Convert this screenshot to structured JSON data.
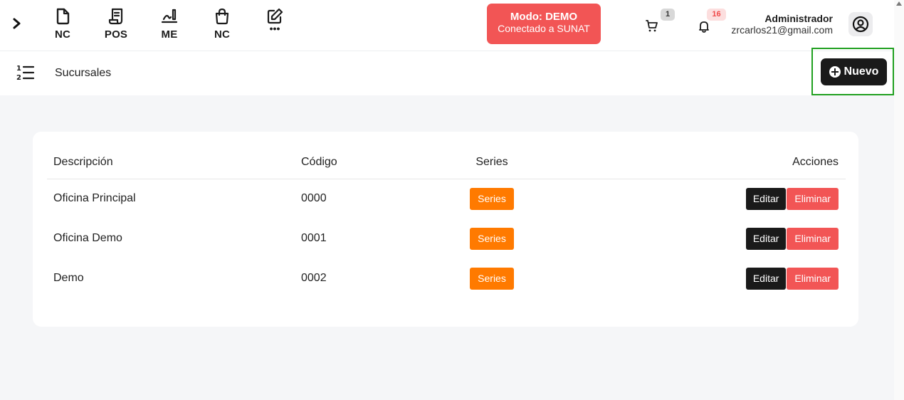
{
  "topbar": {
    "quick_actions": [
      {
        "label": "NC",
        "icon": "document-icon"
      },
      {
        "label": "POS",
        "icon": "receipt-icon"
      },
      {
        "label": "ME",
        "icon": "signature-icon"
      },
      {
        "label": "NC",
        "icon": "shopping-bag-icon"
      },
      {
        "label": "•••",
        "icon": "edit-icon"
      }
    ],
    "mode": {
      "line1": "Modo: DEMO",
      "line2": "Conectado a SUNAT",
      "color": "#f25555"
    },
    "cart_badge": "1",
    "notifications_badge": "16",
    "user": {
      "name": "Administrador",
      "email": "zrcarlos21@gmail.com"
    }
  },
  "subheader": {
    "title": "Sucursales",
    "new_button": "Nuevo"
  },
  "table": {
    "headers": {
      "description": "Descripción",
      "code": "Código",
      "series": "Series",
      "actions": "Acciones"
    },
    "rows": [
      {
        "description": "Oficina Principal",
        "code": "0000"
      },
      {
        "description": "Oficina Demo",
        "code": "0001"
      },
      {
        "description": "Demo",
        "code": "0002"
      }
    ],
    "row_buttons": {
      "series": "Series",
      "edit": "Editar",
      "delete": "Eliminar"
    }
  },
  "colors": {
    "accent_dark": "#1a1a1a",
    "series_orange": "#ff7a00",
    "danger_red": "#f25555",
    "highlight_green": "#20a020"
  }
}
